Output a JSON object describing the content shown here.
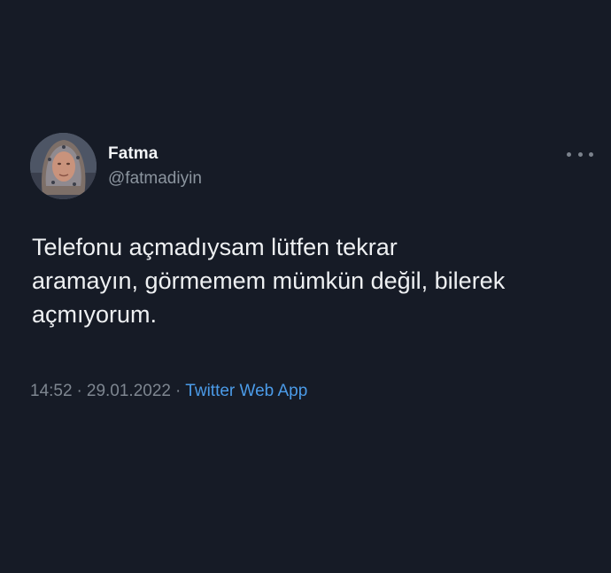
{
  "tweet": {
    "author": {
      "display_name": "Fatma",
      "handle": "@fatmadiyin",
      "avatar_icon": "profile-photo"
    },
    "more_icon": "more-options-icon",
    "text": "Telefonu açmadıysam lütfen tekrar\naramayın, görmemem mümkün değil, bilerek\naçmıyorum.",
    "time": "14:52",
    "date": "29.01.2022",
    "separator": "·",
    "source": "Twitter Web App"
  },
  "colors": {
    "background": "#161b26",
    "link": "#4b9be8",
    "secondary_text": "#7e8690"
  }
}
